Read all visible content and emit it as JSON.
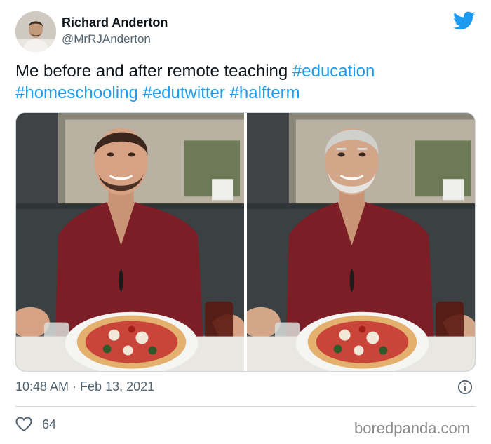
{
  "tweet": {
    "author": {
      "display_name": "Richard Anderton",
      "handle": "@MrRJAnderton"
    },
    "text": {
      "main": "Me before and after remote teaching",
      "hashtags": [
        "#education",
        "#homeschooling",
        "#edutwitter",
        "#halfterm"
      ]
    },
    "timestamp": "10:48 AM · Feb 13, 2021",
    "likes": "64"
  },
  "photos": [
    {
      "label": "before"
    },
    {
      "label": "after"
    }
  ],
  "icons": {
    "brand": "twitter-bird-icon",
    "info": "info-icon",
    "like": "heart-icon"
  },
  "colors": {
    "link": "#1d9bf0",
    "brand": "#1d9bf0",
    "secondary_text": "#536471"
  },
  "watermark": "boredpanda.com"
}
